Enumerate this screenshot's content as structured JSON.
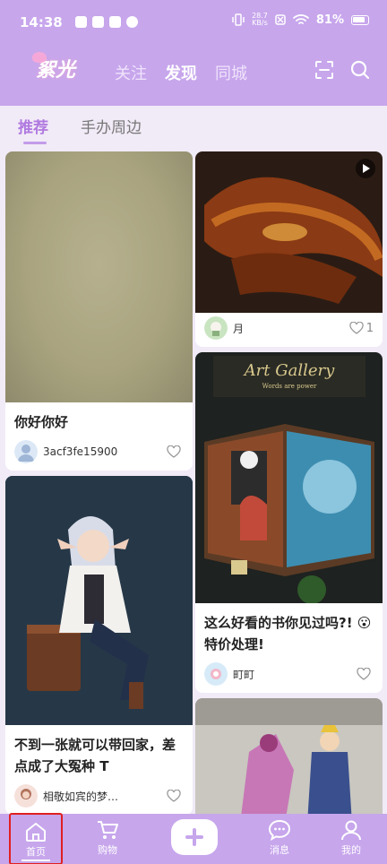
{
  "status_bar": {
    "time": "14:38",
    "net_speed_value": "28.7",
    "net_speed_unit": "KB/s",
    "battery": "81%"
  },
  "header": {
    "logo_text": "絮光",
    "tabs": [
      {
        "label": "关注",
        "active": false
      },
      {
        "label": "发现",
        "active": true
      },
      {
        "label": "同城",
        "active": false
      }
    ]
  },
  "subtabs": [
    {
      "label": "推荐",
      "active": true
    },
    {
      "label": "手办周边",
      "active": false
    }
  ],
  "feed": {
    "left": [
      {
        "title": "你好你好",
        "author": "3acf3fe15900",
        "likes": ""
      },
      {
        "title": "不到一张就可以带回家，差点成了大冤种 T",
        "author": "相敬如宾的梦…",
        "likes": ""
      }
    ],
    "right": [
      {
        "title": "",
        "author": "月",
        "likes": "1",
        "video": true
      },
      {
        "title": "这么好看的书你见过吗?! 😮 特价处理!",
        "author": "町町",
        "likes": ""
      },
      {
        "title": "",
        "author": "",
        "likes": ""
      }
    ]
  },
  "bottom_nav": [
    {
      "label": "首页",
      "icon": "home-icon",
      "active": true
    },
    {
      "label": "购物",
      "icon": "cart-icon",
      "active": false
    },
    {
      "label": "",
      "icon": "plus-icon",
      "active": false
    },
    {
      "label": "消息",
      "icon": "message-icon",
      "active": false
    },
    {
      "label": "我的",
      "icon": "profile-icon",
      "active": false
    }
  ],
  "colors": {
    "header_bg": "#c7a6ec",
    "page_bg": "#f1eaf7",
    "accent": "#b07ae0",
    "active_outline": "#e02020"
  }
}
